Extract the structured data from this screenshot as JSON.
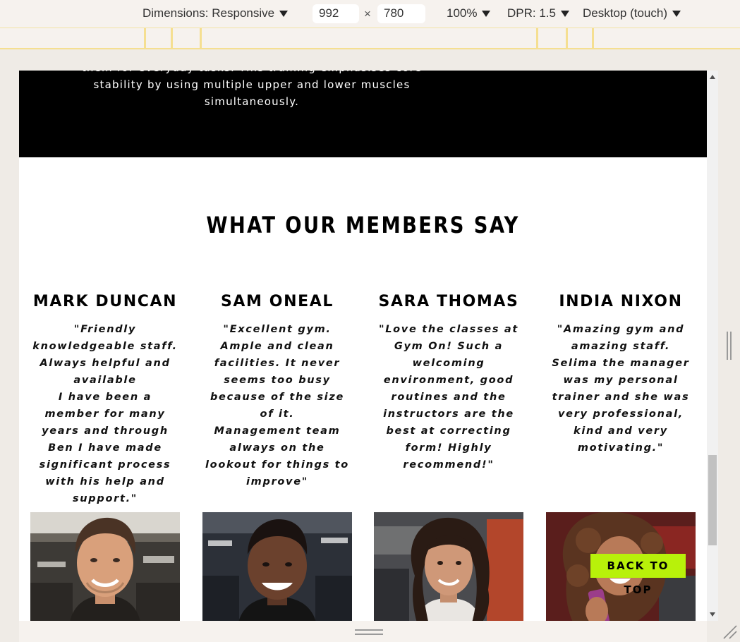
{
  "devtools": {
    "dimensions_label": "Dimensions: Responsive",
    "width_value": "992",
    "times_symbol": "×",
    "height_value": "780",
    "zoom_label": "100%",
    "dpr_label": "DPR: 1.5",
    "device_label": "Desktop (touch)"
  },
  "hero": {
    "text": "them for everyday tasks. This training emphasises core stability by using multiple upper and lower muscles simultaneously."
  },
  "testimonials": {
    "title": "WHAT OUR MEMBERS SAY",
    "members": [
      {
        "name": "MARK DUNCAN",
        "quote": "\"Friendly knowledgeable staff. Always helpful and available\nI have been a member for many years and through Ben I have made significant process with his help and support.\""
      },
      {
        "name": "SAM ONEAL",
        "quote": "\"Excellent gym. Ample and clean facilities. It never seems too busy because of the size of it.\nManagement team always on the lookout for things to improve\""
      },
      {
        "name": "SARA THOMAS",
        "quote": "\"Love the classes at Gym On! Such a welcoming environment, good routines and the instructors are the best at correcting form! Highly recommend!\""
      },
      {
        "name": "INDIA NIXON",
        "quote": "\"Amazing gym and amazing staff. Selima the manager was my personal trainer and she was very professional, kind and very motivating.\""
      }
    ]
  },
  "back_to_top": {
    "label": "BACK TO TOP",
    "color": "#b8f10a"
  },
  "colors": {
    "hero_bg": "#000000",
    "accent": "#b8f10a",
    "devbar_bg": "#f6f2ee",
    "ruler_line": "#f5df91"
  }
}
